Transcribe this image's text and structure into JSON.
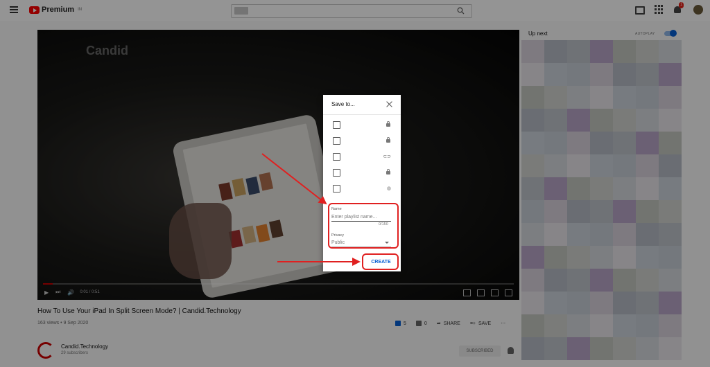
{
  "header": {
    "logo_text": "Premium",
    "logo_sup": "IN",
    "notification_count": "1"
  },
  "video": {
    "watermark": "Candid",
    "time": "0:01 / 0:51",
    "progress": 0.02,
    "title": "How To Use Your iPad In Split Screen Mode? | Candid.Technology",
    "meta": "163 views • 9 Sep 2020",
    "likes": "5",
    "dislikes": "0",
    "share_label": "SHARE",
    "save_label": "SAVE"
  },
  "channel": {
    "name": "Candid.Technology",
    "subs": "29 subscribers",
    "subscribed_label": "SUBSCRIBED"
  },
  "sidebar": {
    "up_next": "Up next",
    "autoplay": "AUTOPLAY"
  },
  "modal": {
    "title": "Save to...",
    "playlists": [
      {
        "icon": "lock-icon"
      },
      {
        "icon": "lock-icon"
      },
      {
        "icon": "link-icon"
      },
      {
        "icon": "lock-icon"
      },
      {
        "icon": "globe-icon"
      }
    ],
    "name_label": "Name",
    "name_placeholder": "Enter playlist name...",
    "counter": "0/150",
    "privacy_label": "Privacy",
    "privacy_value": "Public",
    "create_label": "CREATE"
  },
  "colors": {
    "accent": "#065fd4",
    "highlight": "#e02020",
    "brand": "#ff0000"
  }
}
